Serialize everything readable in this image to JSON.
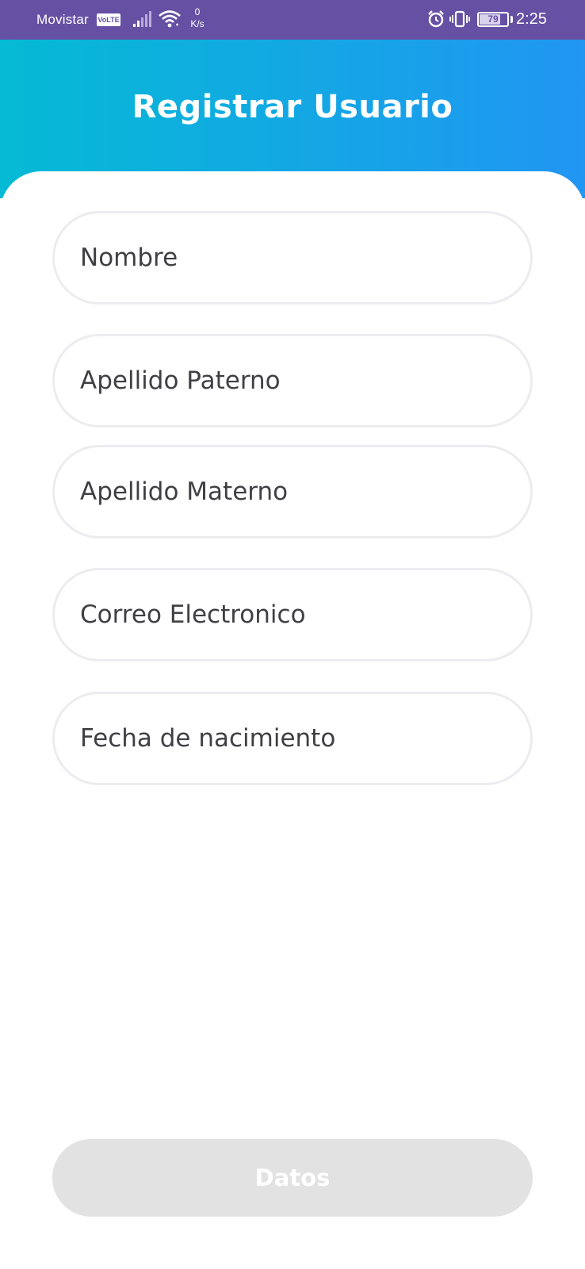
{
  "status_bar": {
    "carrier": "Movistar",
    "volte": "VoLTE",
    "speed_value": "0",
    "speed_unit": "K/s",
    "battery_percent": 79,
    "battery_text": "79",
    "time": "2:25",
    "icons": [
      "signal-icon",
      "wifi-icon",
      "alarm-icon",
      "vibrate-icon",
      "battery-icon"
    ]
  },
  "header": {
    "title": "Registrar Usuario",
    "gradient": [
      "#05bad4",
      "#2196f3"
    ]
  },
  "form": {
    "fields": [
      {
        "placeholder": "Nombre"
      },
      {
        "placeholder": "Apellido Paterno"
      },
      {
        "placeholder": "Apellido Materno"
      },
      {
        "placeholder": "Correo Electronico"
      },
      {
        "placeholder": "Fecha de nacimiento"
      }
    ],
    "submit_label": "Datos"
  },
  "colors": {
    "status_bar": "#6650a4",
    "field_border": "#ececf0",
    "button_disabled": "#e2e2e2",
    "label_text": "#404044"
  }
}
